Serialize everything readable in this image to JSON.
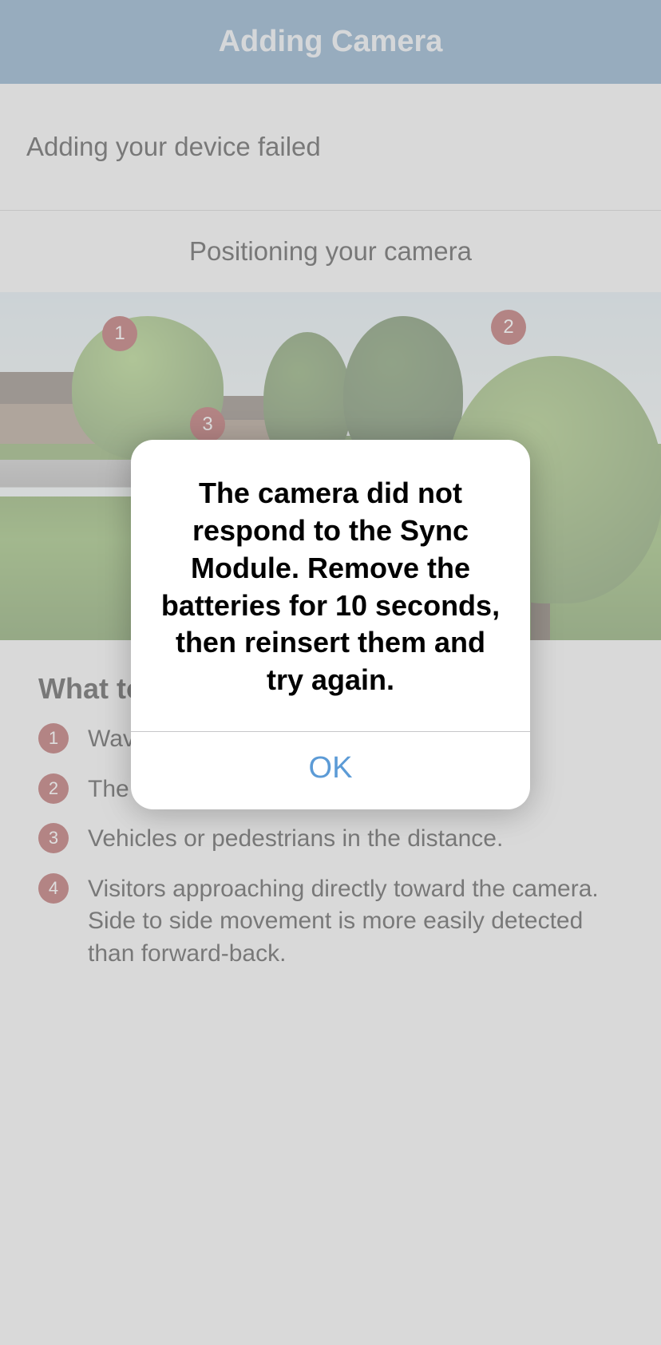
{
  "header": {
    "title": "Adding Camera"
  },
  "status": {
    "message": "Adding your device failed"
  },
  "positioning": {
    "heading": "Positioning your camera"
  },
  "scene_badges": [
    "1",
    "2",
    "3"
  ],
  "avoid": {
    "title": "What to avoid",
    "items": [
      "Waving tree branches and plants.",
      "The sun at any time of day.",
      "Vehicles or pedestrians in the distance.",
      "Visitors approaching directly toward the camera. Side to side movement is more easily detected than forward-back."
    ],
    "numbers": [
      "1",
      "2",
      "3",
      "4"
    ]
  },
  "modal": {
    "message": "The camera did not respond to the Sync Module. Remove the batteries for 10 seconds, then reinsert them and try again.",
    "ok": "OK"
  }
}
